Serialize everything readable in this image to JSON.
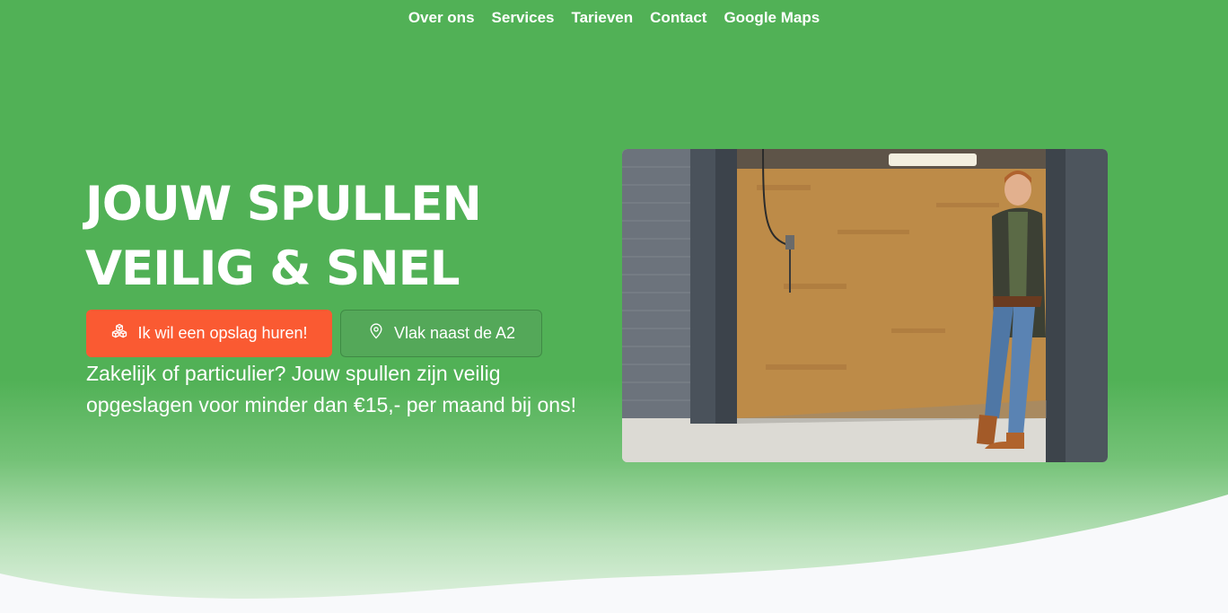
{
  "nav": {
    "items": [
      {
        "label": "Over ons"
      },
      {
        "label": "Services"
      },
      {
        "label": "Tarieven"
      },
      {
        "label": "Contact"
      },
      {
        "label": "Google Maps"
      }
    ]
  },
  "hero": {
    "title_line1": "JOUW SPULLEN",
    "title_line2": "VEILIG & SNEL",
    "primary_button": {
      "label": "Ik wil een opslag huren!",
      "icon": "boxes-icon"
    },
    "secondary_button": {
      "label": "Vlak naast de A2",
      "icon": "map-pin-icon"
    },
    "lead": "Zakelijk of particulier? Jouw spullen zijn veilig opgeslagen voor minder dan €15,- per maand bij ons!"
  },
  "colors": {
    "hero_green": "#51b156",
    "primary_orange": "#fa5a32",
    "text_white": "#ffffff",
    "page_background": "#f8f9fb"
  }
}
